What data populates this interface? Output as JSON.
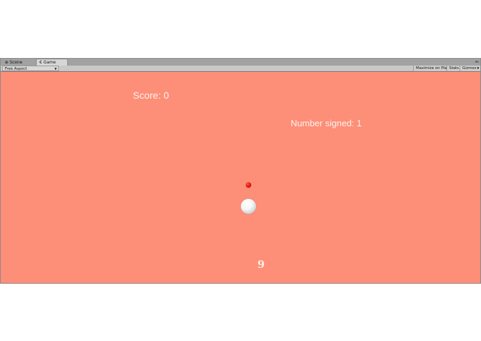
{
  "tabs": [
    {
      "label": "Scene",
      "icon": "scene-icon"
    },
    {
      "label": "Game",
      "icon": "game-icon",
      "active": true
    }
  ],
  "toolbar": {
    "aspect": "Free Aspect",
    "maximize_label": "Maximize on Play",
    "stats_label": "Stats",
    "gizmos_label": "Gizmos"
  },
  "game": {
    "background": "#fd8e77",
    "score_text": "Score: 0",
    "signed_text": "Number signed: 1",
    "bottom_number": "9"
  }
}
